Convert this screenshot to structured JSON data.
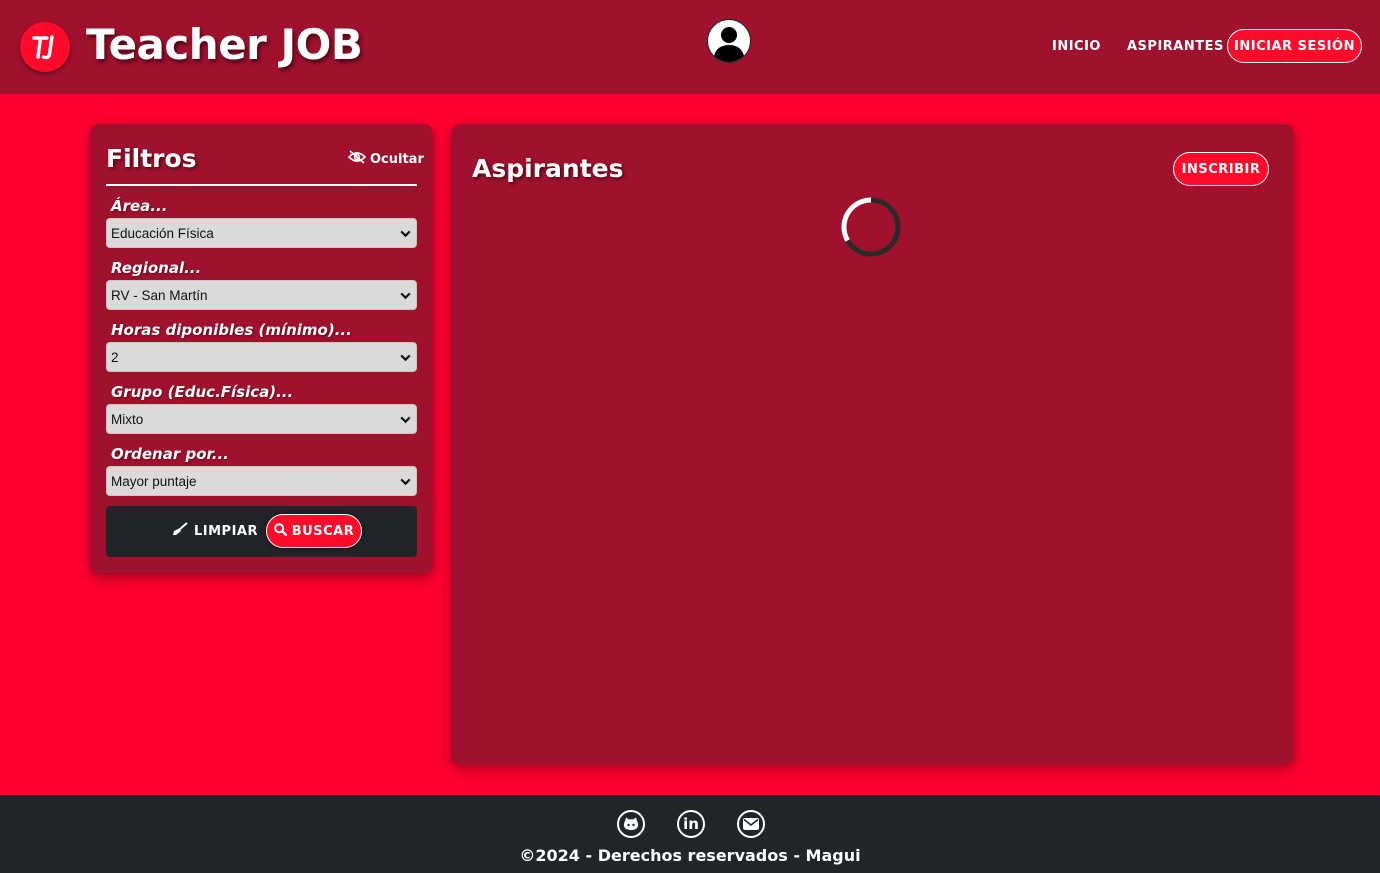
{
  "header": {
    "logo_text": "Teacher JOB",
    "nav": {
      "home_label": "INICIO",
      "applicants_label": "ASPIRANTES",
      "login_label": "INICIAR SESIÓN"
    }
  },
  "filters": {
    "title": "Filtros",
    "hide_label": "Ocultar",
    "fields": [
      {
        "label": "Área...",
        "value": "Educación Física"
      },
      {
        "label": "Regional...",
        "value": "RV - San Martín"
      },
      {
        "label": "Horas diponibles (mínimo)...",
        "value": "2"
      },
      {
        "label": "Grupo (Educ.Física)...",
        "value": "Mixto"
      },
      {
        "label": "Ordenar por...",
        "value": "Mayor puntaje"
      }
    ],
    "clear_label": "LIMPIAR",
    "search_label": "BUSCAR"
  },
  "main": {
    "title": "Aspirantes",
    "enroll_label": "INSCRIBIR"
  },
  "footer": {
    "copyright": "©2024 - Derechos reservados - Magui",
    "social_icons": [
      "github-icon",
      "linkedin-icon",
      "email-icon"
    ]
  },
  "colors": {
    "header_bg": "#a0112e",
    "page_bg": "#ff0030",
    "accent": "#ff0a2a",
    "footer_bg": "#212529"
  }
}
